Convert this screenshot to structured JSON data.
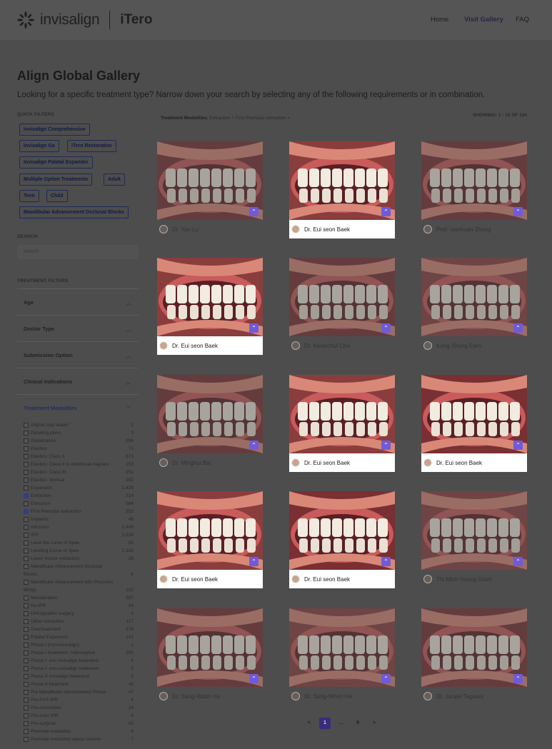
{
  "header": {
    "brand": "invisalign",
    "brand2": "iTero",
    "nav": [
      {
        "label": "Home"
      },
      {
        "label": "Visit Gallery"
      },
      {
        "label": "FAQ"
      }
    ]
  },
  "page": {
    "title": "Align Global Gallery",
    "subtitle": "Looking for a specific treatment type? Narrow down your search by selecting any of the following requirements or in combination."
  },
  "sidebar": {
    "quick_filters_label": "QUICK FILTERS",
    "chips": [
      "Invisalign Comprehensive",
      "Invisalign Go",
      "iTero Restorative",
      "Invisalign Palatal Expander",
      "Multiple Option Treatments",
      "Adult",
      "Teen",
      "Child",
      "Mandibular Advancement Occlusal Blocks"
    ],
    "search_label": "SEARCH",
    "search_placeholder": "Search",
    "treatment_filters_label": "TREATMENT FILTERS",
    "filters": [
      {
        "label": "Age",
        "chevron": "chevron-up"
      },
      {
        "label": "Doctor Type",
        "chevron": "chevron-up"
      },
      {
        "label": "Submission Option",
        "chevron": "chevron-up"
      },
      {
        "label": "Clinical Indications",
        "chevron": "chevron-up"
      },
      {
        "label": "Treatment Modalities",
        "chevron": "chevron-down"
      }
    ],
    "modalities": [
      {
        "name": "Aligner tray seater",
        "count": "2",
        "checked": false
      },
      {
        "name": "Detailing pliers",
        "count": "3",
        "checked": false
      },
      {
        "name": "Distalization",
        "count": "996",
        "checked": false
      },
      {
        "name": "Elastics",
        "count": "71",
        "checked": false
      },
      {
        "name": "Elastics: Class II",
        "count": "673",
        "checked": false
      },
      {
        "name": "Elastics: Class II in Additional Aligners",
        "count": "153",
        "checked": false
      },
      {
        "name": "Elastics: Class III",
        "count": "252",
        "checked": false
      },
      {
        "name": "Elastics: Vertical",
        "count": "282",
        "checked": false
      },
      {
        "name": "Expansion",
        "count": "1,429",
        "checked": false
      },
      {
        "name": "Extraction",
        "count": "214",
        "checked": true
      },
      {
        "name": "Extrusion",
        "count": "664",
        "checked": false
      },
      {
        "name": "First Premolar extraction",
        "count": "253",
        "checked": true
      },
      {
        "name": "Implants",
        "count": "46",
        "checked": false
      },
      {
        "name": "Intrusion",
        "count": "1,449",
        "checked": false
      },
      {
        "name": "IPR",
        "count": "1,334",
        "checked": false
      },
      {
        "name": "Level the curve of Spee",
        "count": "55",
        "checked": false
      },
      {
        "name": "Leveling Curve of Spee",
        "count": "1,333",
        "checked": false
      },
      {
        "name": "Lower incisor extraction",
        "count": "38",
        "checked": false
      },
      {
        "name": "Mandibular Advancement Occlusal",
        "count": "",
        "checked": false
      },
      {
        "name": "Blocks",
        "count": "6",
        "checked": null
      },
      {
        "name": "Mandibular Advancement with Precision",
        "count": "",
        "checked": false
      },
      {
        "name": "Wings",
        "count": "132",
        "checked": null
      },
      {
        "name": "Mesialization",
        "count": "287",
        "checked": false
      },
      {
        "name": "No-IPR",
        "count": "16",
        "checked": false
      },
      {
        "name": "Orthognathic surgery",
        "count": "4",
        "checked": false
      },
      {
        "name": "Other extraction",
        "count": "117",
        "checked": false
      },
      {
        "name": "Overtreatment",
        "count": "278",
        "checked": false
      },
      {
        "name": "Palatal Expansion",
        "count": "141",
        "checked": false
      },
      {
        "name": "Phase I (non-Invisalign)",
        "count": "1",
        "checked": false
      },
      {
        "name": "Phase I treatment / Interceptive",
        "count": "200",
        "checked": false
      },
      {
        "name": "Phase I: non Invisalign treatment",
        "count": "4",
        "checked": false
      },
      {
        "name": "Phase I: non-Invisalign treatment",
        "count": "2",
        "checked": false
      },
      {
        "name": "Phase II Invisalign treatment",
        "count": "2",
        "checked": false
      },
      {
        "name": "Phase II treatment",
        "count": "45",
        "checked": false
      },
      {
        "name": "Pre Mandibular Advancement Phase",
        "count": "47",
        "checked": false
      },
      {
        "name": "Pre-PVS IPR",
        "count": "4",
        "checked": false
      },
      {
        "name": "Pre-restorative",
        "count": "19",
        "checked": false
      },
      {
        "name": "Pre-scan IPR",
        "count": "4",
        "checked": false
      },
      {
        "name": "Pre-surgical",
        "count": "42",
        "checked": false
      },
      {
        "name": "Premolar extraction",
        "count": "8",
        "checked": false
      },
      {
        "name": "Premolar extraction space closure",
        "count": "7",
        "checked": false
      }
    ]
  },
  "results": {
    "applied_label": "Treatment Modalities:",
    "applied_tags": "Extraction ×  First Premolar extraction ×",
    "showing": "SHOWING: 1 - 15 OF 124",
    "cards": [
      {
        "doctor": "Dr. Yan Lu",
        "highlight": false
      },
      {
        "doctor": "Dr. Eui seon Baek",
        "highlight": true
      },
      {
        "doctor": "Prof. xianhuan Zhong",
        "highlight": false
      },
      {
        "doctor": "Dr. Eui seon Baek",
        "highlight": true
      },
      {
        "doctor": "Dr. Kwanchul Cho",
        "highlight": false
      },
      {
        "doctor": "Kong Sheng Earn",
        "highlight": false
      },
      {
        "doctor": "Dr. Minghui Bai",
        "highlight": false
      },
      {
        "doctor": "Dr. Eui seon Baek",
        "highlight": true
      },
      {
        "doctor": "Dr. Eui seon Baek",
        "highlight": true
      },
      {
        "doctor": "Dr. Eui seon Baek",
        "highlight": true
      },
      {
        "doctor": "Dr. Eui seon Baek",
        "highlight": true
      },
      {
        "doctor": "Thi Minh Huong Doan",
        "highlight": false
      },
      {
        "doctor": "Dr. Sang-Woon Ha",
        "highlight": false
      },
      {
        "doctor": "Dr. Sang-Woon Ha",
        "highlight": false
      },
      {
        "doctor": "Dr. Junpei Tagawa",
        "highlight": false
      }
    ]
  },
  "pagination": {
    "prev": "<",
    "current": "1",
    "ellipsis": "...",
    "last": "9",
    "next": ">"
  }
}
